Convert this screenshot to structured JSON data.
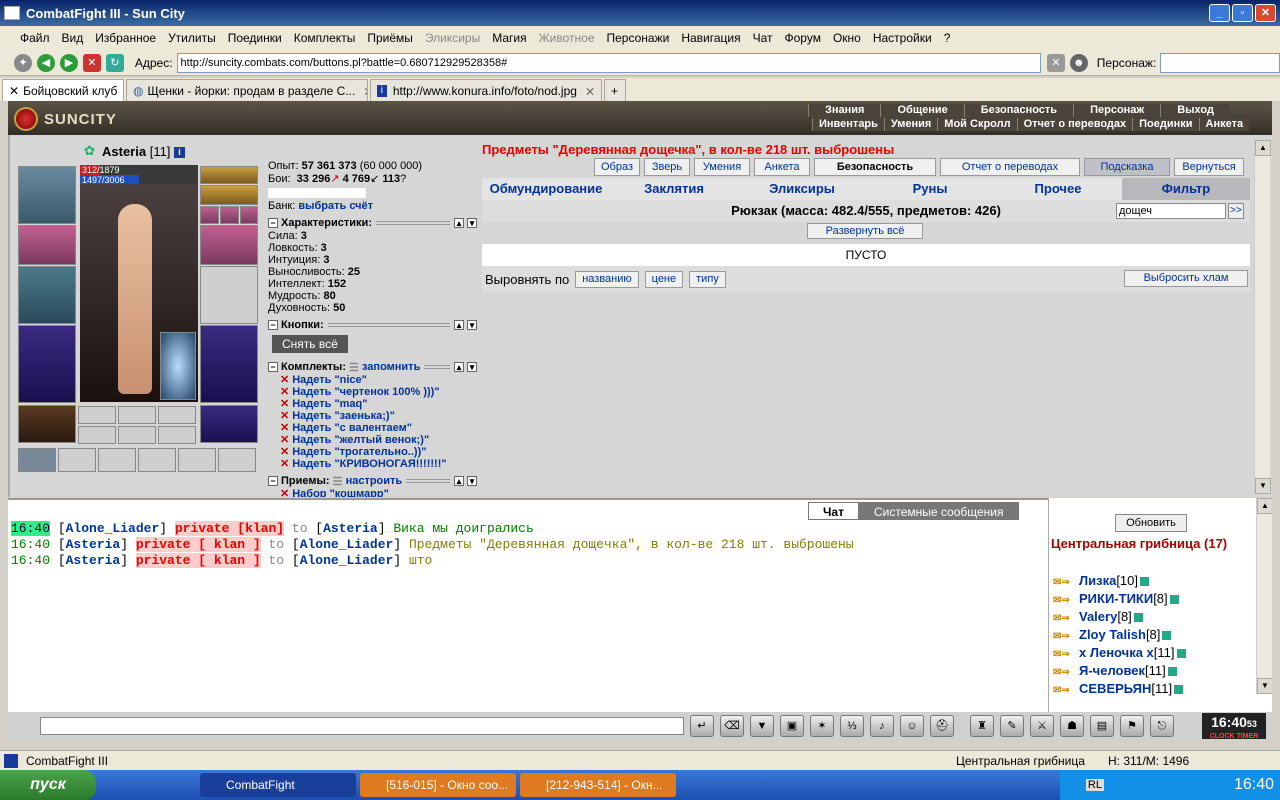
{
  "window": {
    "title": "CombatFight III - Sun City"
  },
  "menu": [
    "Файл",
    "Вид",
    "Избранное",
    "Утилиты",
    "Поединки",
    "Комплекты",
    "Приёмы",
    "Эликсиры",
    "Магия",
    "Животное",
    "Персонажи",
    "Навигация",
    "Чат",
    "Форум",
    "Окно",
    "Настройки",
    "?"
  ],
  "menu_dim": [
    7,
    9
  ],
  "address": {
    "label": "Адрес:",
    "url": "http://suncity.combats.com/buttons.pl?battle=0.680712929528358#",
    "char_label": "Персонаж:"
  },
  "tabs": [
    {
      "label": "Бойцовский клуб"
    },
    {
      "label": "Щенки - йорки: продам в разделе С..."
    },
    {
      "label": "http://www.konura.info/foto/nod.jpg"
    }
  ],
  "header": {
    "logo": "SUNCITY",
    "top_nav": [
      "Знания",
      "Общение",
      "Безопасность",
      "Персонаж",
      "Выход"
    ],
    "sub_nav": [
      "Инвентарь",
      "Умения",
      "Мой Скролл",
      "Отчет о переводах",
      "Поединки",
      "Анкета"
    ]
  },
  "character": {
    "name": "Asteria",
    "level": "[11]",
    "hp": "312/1879",
    "hp_ratio": 0.166,
    "mp": "1497/3006",
    "mp_ratio": 0.498
  },
  "stats": {
    "exp_label": "Опыт:",
    "exp": "57 361 373",
    "exp_next": "(60 000 000)",
    "fights_label": "Бои:",
    "wins": "33 296",
    "losses": "4 769",
    "draws": "113",
    "bank_label": "Банк:",
    "bank_link": "выбрать счёт",
    "chars_title": "Характеристики:",
    "attrs": [
      {
        "label": "Сила:",
        "value": "3"
      },
      {
        "label": "Ловкость:",
        "value": "3"
      },
      {
        "label": "Интуиция:",
        "value": "3"
      },
      {
        "label": "Выносливость:",
        "value": "25"
      },
      {
        "label": "Интеллект:",
        "value": "152"
      },
      {
        "label": "Мудрость:",
        "value": "80"
      },
      {
        "label": "Духовность:",
        "value": "50"
      }
    ],
    "buttons_title": "Кнопки:",
    "remove_all": "Снять всё",
    "sets_title": "Комплекты:",
    "sets_remember": "запомнить",
    "sets": [
      "Надеть \"nice\"",
      "Надеть \"чертенок 100% )))\"",
      "Надеть \"maq\"",
      "Надеть \"заенька;)\"",
      "Надеть \"с валентаем\"",
      "Надеть \"желтый венок;)\"",
      "Надеть \"трогательно..))\"",
      "Надеть \"КРИВОНОГАЯ!!!!!!!\""
    ],
    "tricks_title": "Приемы:",
    "tricks_setup": "настроить",
    "tricks_first": "Набор \"кошмарр\""
  },
  "inventory": {
    "message": "Предметы \"Деревянная дощечка\", в кол-ве 218 шт. выброшены",
    "top_buttons": [
      "Образ",
      "Зверь",
      "Умения",
      "Анкета",
      "Безопасность",
      "Отчет о переводах",
      "Подсказка",
      "Вернуться"
    ],
    "categories": [
      "Обмундирование",
      "Заклятия",
      "Эликсиры",
      "Руны",
      "Прочее",
      "Фильтр"
    ],
    "bag": "Рюкзак (масса: 482.4/555, предметов: 426)",
    "search": "дощеч",
    "search_go": ">>",
    "expand_all": "Развернуть всё",
    "empty": "ПУСТО",
    "sort_label": "Выровнять по",
    "sort_options": [
      "названию",
      "цене",
      "типу"
    ],
    "drop_junk": "Выбросить хлам"
  },
  "chat": {
    "tabs": [
      "Чат",
      "Системные сообщения"
    ],
    "lines": [
      {
        "ts": "16:40",
        "from": "Alone_Liader",
        "priv": "private [klan]",
        "to_word": "to",
        "to": "Asteria",
        "text": "Вика мы доигрались",
        "hl": true
      },
      {
        "ts": "16:40",
        "from": "Asteria",
        "priv": "private [ klan ]",
        "to_word": "to",
        "to": "Alone_Liader",
        "text": "Предметы \"Деревянная дощечка\", в кол-ве 218 шт. выброшены",
        "hl": false
      },
      {
        "ts": "16:40",
        "from": "Asteria",
        "priv": "private [ klan ]",
        "to_word": "to",
        "to": "Alone_Liader",
        "text": "што",
        "hl": false
      }
    ]
  },
  "location": {
    "refresh": "Обновить",
    "title": "Центральная грибница (17)",
    "players": [
      {
        "name": "Лизка",
        "lvl": "[10]"
      },
      {
        "name": "РИКИ-ТИКИ",
        "lvl": "[8]"
      },
      {
        "name": "Valery",
        "lvl": "[8]"
      },
      {
        "name": "Zloy Talish",
        "lvl": "[8]"
      },
      {
        "name": "x Леночка x",
        "lvl": "[11]"
      },
      {
        "name": "Я-человек",
        "lvl": "[11]"
      },
      {
        "name": "СЕВЕРЬЯН",
        "lvl": "[11]"
      }
    ]
  },
  "clock": {
    "time": "16:40",
    "sec": "53",
    "label": "CLOCK TIMER"
  },
  "statusbar": {
    "app": "CombatFight III",
    "location": "Центральная грибница",
    "hm": "H: 311/M: 1496"
  },
  "taskbar": {
    "start": "пуск",
    "tasks": [
      "CombatFight",
      "[516-015] - Окно соо...",
      "[212-943-514] - Окн..."
    ],
    "lang": "RL",
    "time": "16:40"
  },
  "colors": {
    "accent": "#003399",
    "alert": "#e00000",
    "brand": "#3a6ea5"
  }
}
